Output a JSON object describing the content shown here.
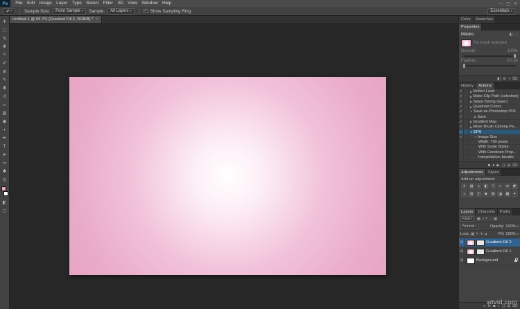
{
  "watermark": "wtvid.com",
  "glyphs": {
    "chevron_down": "▾",
    "checkmark": "✓",
    "eyedropper": "✐",
    "eye": "⊙"
  },
  "menu_bar": {
    "logo": "Ps",
    "items": [
      "File",
      "Edit",
      "Image",
      "Layer",
      "Type",
      "Select",
      "Filter",
      "3D",
      "View",
      "Window",
      "Help"
    ],
    "window_controls": [
      "—",
      "▢",
      "✕"
    ]
  },
  "options_bar": {
    "sample_size_label": "Sample Size:",
    "sample_size_value": "Point Sample",
    "sample_label": "Sample:",
    "sample_value": "All Layers",
    "sampling_ring_label": "Show Sampling Ring",
    "sampling_ring_checked": true,
    "workspace_button": "Essentials"
  },
  "document_tab": {
    "title": "Untitled-1 @ 66.7% (Gradient Fill 2, RGB/8) *",
    "close": "×"
  },
  "toolbar": {
    "tools": [
      {
        "name": "move-tool-icon",
        "glyph": "✛"
      },
      {
        "name": "marquee-tool-icon",
        "glyph": "⬚"
      },
      {
        "name": "lasso-tool-icon",
        "glyph": "↯"
      },
      {
        "name": "quick-selection-tool-icon",
        "glyph": "❋"
      },
      {
        "name": "crop-tool-icon",
        "glyph": "⌗"
      },
      {
        "name": "eyedropper-tool-icon",
        "glyph": "✐"
      },
      {
        "name": "healing-brush-tool-icon",
        "glyph": "⊕"
      },
      {
        "name": "brush-tool-icon",
        "glyph": "✎"
      },
      {
        "name": "clone-stamp-tool-icon",
        "glyph": "♜"
      },
      {
        "name": "history-brush-tool-icon",
        "glyph": "↺"
      },
      {
        "name": "eraser-tool-icon",
        "glyph": "▱"
      },
      {
        "name": "gradient-tool-icon",
        "glyph": "▥"
      },
      {
        "name": "blur-tool-icon",
        "glyph": "◉"
      },
      {
        "name": "dodge-tool-icon",
        "glyph": "◖"
      },
      {
        "name": "pen-tool-icon",
        "glyph": "✒"
      },
      {
        "name": "type-tool-icon",
        "glyph": "T"
      },
      {
        "name": "path-selection-tool-icon",
        "glyph": "➤"
      },
      {
        "name": "rectangle-tool-icon",
        "glyph": "▭"
      },
      {
        "name": "hand-tool-icon",
        "glyph": "✱"
      },
      {
        "name": "zoom-tool-icon",
        "glyph": "◎"
      }
    ],
    "bottom_tools": [
      {
        "name": "quick-mask-icon",
        "glyph": "◧"
      },
      {
        "name": "screen-mode-icon",
        "glyph": "▢"
      }
    ],
    "foreground_color": "#e6a6c6",
    "background_color": "#ffffff"
  },
  "canvas": {
    "fill_center": "#ffffff",
    "fill_edge": "#e7a4c5"
  },
  "right_panels": {
    "color_swatches_tabs": [
      {
        "label": "Color",
        "active": false
      },
      {
        "label": "Swatches",
        "active": false
      }
    ],
    "properties": {
      "tabs": [
        {
          "label": "Properties",
          "active": true
        }
      ],
      "section_title": "Masks",
      "header_icons": [
        {
          "name": "pixel-mask-icon",
          "glyph": "◧"
        },
        {
          "name": "vector-mask-icon",
          "glyph": "⬚"
        }
      ],
      "no_mask_text": "No mask selected",
      "density_label": "Density:",
      "density_value": "100%",
      "feather_label": "Feather:",
      "feather_value": "0.0 px",
      "footer_icons": [
        {
          "name": "mask-edge-icon",
          "glyph": "◧"
        },
        {
          "name": "color-range-icon",
          "glyph": "⊚"
        },
        {
          "name": "invert-mask-icon",
          "glyph": "◑"
        },
        {
          "name": "delete-mask-icon",
          "glyph": "⌦"
        }
      ]
    },
    "actions": {
      "tabs": [
        {
          "label": "History",
          "active": false
        },
        {
          "label": "Actions",
          "active": true
        }
      ],
      "items": [
        {
          "label": "Molten Lead",
          "indent": 0,
          "check": "✓",
          "arrow": "▶",
          "selected": false
        },
        {
          "label": "Make Clip Path (selection)",
          "indent": 0,
          "check": "✓",
          "arrow": "▶",
          "selected": false
        },
        {
          "label": "Sepia Toning (layer)",
          "indent": 0,
          "check": "✓",
          "arrow": "▶",
          "selected": false
        },
        {
          "label": "Quadrant Colors",
          "indent": 0,
          "check": "✓",
          "arrow": "▶",
          "selected": false
        },
        {
          "label": "Save as Photoshop PDF",
          "indent": 0,
          "check": "✓",
          "arrow": "▼",
          "selected": false
        },
        {
          "label": "Save",
          "indent": 1,
          "check": "✓",
          "arrow": "▶",
          "selected": false
        },
        {
          "label": "Gradient Map",
          "indent": 0,
          "check": "✓",
          "arrow": "▶",
          "selected": false
        },
        {
          "label": "Mixer Brush Cloning Pa...",
          "indent": 0,
          "check": "✓",
          "arrow": "▶",
          "selected": false
        },
        {
          "label": "EPS",
          "indent": 0,
          "check": "✓",
          "arrow": "▼",
          "selected": true
        },
        {
          "label": "Image Size",
          "indent": 1,
          "check": "✓",
          "arrow": "▼",
          "selected": false
        },
        {
          "label": "Width: 750 pixels",
          "indent": 2,
          "check": "",
          "arrow": "",
          "selected": false
        },
        {
          "label": "With Scale Styles",
          "indent": 2,
          "check": "",
          "arrow": "",
          "selected": false
        },
        {
          "label": "With Constrain Prop...",
          "indent": 2,
          "check": "",
          "arrow": "",
          "selected": false
        },
        {
          "label": "Interpolation: bicubic",
          "indent": 2,
          "check": "",
          "arrow": "",
          "selected": false
        }
      ],
      "footer_icons": [
        {
          "name": "stop-icon",
          "glyph": "■"
        },
        {
          "name": "record-icon",
          "glyph": "●"
        },
        {
          "name": "play-icon",
          "glyph": "▶"
        },
        {
          "name": "new-set-icon",
          "glyph": "❏"
        },
        {
          "name": "new-action-icon",
          "glyph": "⊞"
        },
        {
          "name": "delete-action-icon",
          "glyph": "⌦"
        }
      ]
    },
    "adjustments": {
      "tabs": [
        {
          "label": "Adjustments",
          "active": true
        },
        {
          "label": "Styles",
          "active": false
        }
      ],
      "hint": "Add an adjustment",
      "icons": [
        {
          "name": "brightness-contrast-icon",
          "glyph": "☀"
        },
        {
          "name": "levels-icon",
          "glyph": "▤"
        },
        {
          "name": "curves-icon",
          "glyph": "∿"
        },
        {
          "name": "exposure-icon",
          "glyph": "◧"
        },
        {
          "name": "vibrance-icon",
          "glyph": "▽"
        },
        {
          "name": "hue-saturation-icon",
          "glyph": "◐"
        },
        {
          "name": "color-balance-icon",
          "glyph": "⚖"
        },
        {
          "name": "black-white-icon",
          "glyph": "◩"
        },
        {
          "name": "photo-filter-icon",
          "glyph": "◒"
        },
        {
          "name": "channel-mixer-icon",
          "glyph": "▥"
        },
        {
          "name": "color-lookup-icon",
          "glyph": "◫"
        },
        {
          "name": "invert-icon",
          "glyph": "◙"
        },
        {
          "name": "posterize-icon",
          "glyph": "▨"
        },
        {
          "name": "threshold-icon",
          "glyph": "◪"
        },
        {
          "name": "gradient-map-icon",
          "glyph": "▦"
        },
        {
          "name": "selective-color-icon",
          "glyph": "✦"
        }
      ]
    },
    "layers": {
      "tabs": [
        {
          "label": "Layers",
          "active": true
        },
        {
          "label": "Channels",
          "active": false
        },
        {
          "label": "Paths",
          "active": false
        }
      ],
      "filter_label": "Kind",
      "filter_icons": [
        {
          "name": "filter-pixel-icon",
          "glyph": "▣"
        },
        {
          "name": "filter-adjustment-icon",
          "glyph": "◑"
        },
        {
          "name": "filter-type-icon",
          "glyph": "T"
        },
        {
          "name": "filter-shape-icon",
          "glyph": "⬚"
        },
        {
          "name": "filter-smart-icon",
          "glyph": "▦"
        }
      ],
      "blend_mode": "Normal",
      "opacity_label": "Opacity:",
      "opacity_value": "100%",
      "lock_label": "Lock:",
      "lock_icons": [
        {
          "name": "lock-transparency-icon",
          "glyph": "▦"
        },
        {
          "name": "lock-pixels-icon",
          "glyph": "✎"
        },
        {
          "name": "lock-position-icon",
          "glyph": "✛"
        },
        {
          "name": "lock-all-icon",
          "glyph": "◘"
        }
      ],
      "fill_label": "Fill:",
      "fill_value": "100%",
      "rows": [
        {
          "name": "Gradient Fill 2",
          "selected": true,
          "thumbs": [
            "gradient",
            "mask"
          ],
          "locked": false
        },
        {
          "name": "Gradient Fill 1",
          "selected": false,
          "thumbs": [
            "gradient",
            "mask"
          ],
          "locked": false
        },
        {
          "name": "Background",
          "selected": false,
          "thumbs": [
            "white"
          ],
          "locked": true
        }
      ],
      "footer_icons": [
        {
          "name": "link-layers-icon",
          "glyph": "∞"
        },
        {
          "name": "layer-style-icon",
          "glyph": "fx"
        },
        {
          "name": "add-mask-icon",
          "glyph": "◙"
        },
        {
          "name": "new-adjustment-icon",
          "glyph": "◑"
        },
        {
          "name": "new-group-icon",
          "glyph": "❏"
        },
        {
          "name": "new-layer-icon",
          "glyph": "⊞"
        },
        {
          "name": "delete-layer-icon",
          "glyph": "⌦"
        }
      ]
    }
  }
}
